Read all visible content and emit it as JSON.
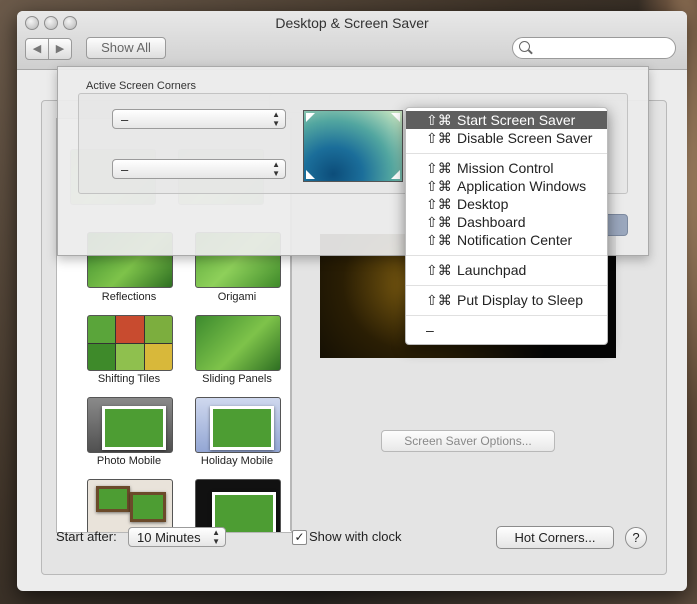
{
  "window": {
    "title": "Desktop & Screen Saver",
    "show_all": "Show All",
    "back_glyph": "◀",
    "forward_glyph": "▶",
    "search_placeholder": ""
  },
  "screen_savers": [
    {
      "label": "Reflections"
    },
    {
      "label": "Origami"
    },
    {
      "label": "Shifting Tiles"
    },
    {
      "label": "Sliding Panels"
    },
    {
      "label": "Photo Mobile"
    },
    {
      "label": "Holiday Mobile"
    }
  ],
  "screen_saver_options": "Screen Saver Options...",
  "bottom": {
    "start_after_label": "Start after:",
    "start_after_value": "10 Minutes",
    "show_with_clock_label": "Show with clock",
    "show_with_clock_checked": true,
    "check_glyph": "✓",
    "hot_corners_button": "Hot Corners...",
    "help_glyph": "?"
  },
  "sheet": {
    "title": "Active Screen Corners",
    "top_left_value": "–",
    "bottom_left_value": "–"
  },
  "popup_arrows": {
    "up": "▲",
    "down": "▼"
  },
  "corner_menu": {
    "selected_index": 0,
    "items": [
      {
        "modifiers": "⇧⌘",
        "label": "Start Screen Saver"
      },
      {
        "modifiers": "⇧⌘",
        "label": "Disable Screen Saver"
      },
      {
        "modifiers": "⇧⌘",
        "label": "Mission Control"
      },
      {
        "modifiers": "⇧⌘",
        "label": "Application Windows"
      },
      {
        "modifiers": "⇧⌘",
        "label": "Desktop"
      },
      {
        "modifiers": "⇧⌘",
        "label": "Dashboard"
      },
      {
        "modifiers": "⇧⌘",
        "label": "Notification Center"
      },
      {
        "modifiers": "⇧⌘",
        "label": "Launchpad"
      },
      {
        "modifiers": "⇧⌘",
        "label": "Put Display to Sleep"
      },
      {
        "modifiers": "",
        "label": "–"
      }
    ]
  },
  "colors": {
    "menu_highlight": "#5f5f5f",
    "window_bg": "#ececec"
  }
}
